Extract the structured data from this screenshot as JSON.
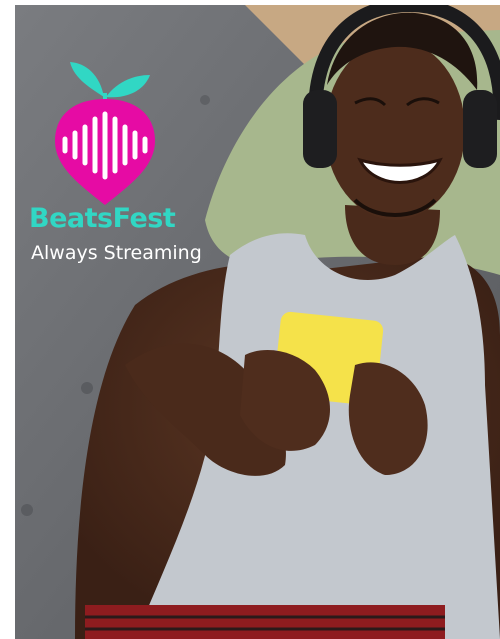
{
  "brand": {
    "name": "BeatsFest",
    "tagline": "Always Streaming",
    "colors": {
      "logo_fill": "#e60ba4",
      "leaf": "#31d7c4",
      "name_text": "#31d7c4",
      "tagline_text": "#ffffff"
    },
    "icons": [
      "radish-sound-wave-logo"
    ]
  },
  "photo": {
    "colors": {
      "couch": "#6f7175",
      "pillow": "#a7b78d",
      "tank_top": "#c3c8ce",
      "phone": "#f5e24a",
      "skin": "#4a2a1b",
      "shorts": "#8e1c1f"
    }
  }
}
